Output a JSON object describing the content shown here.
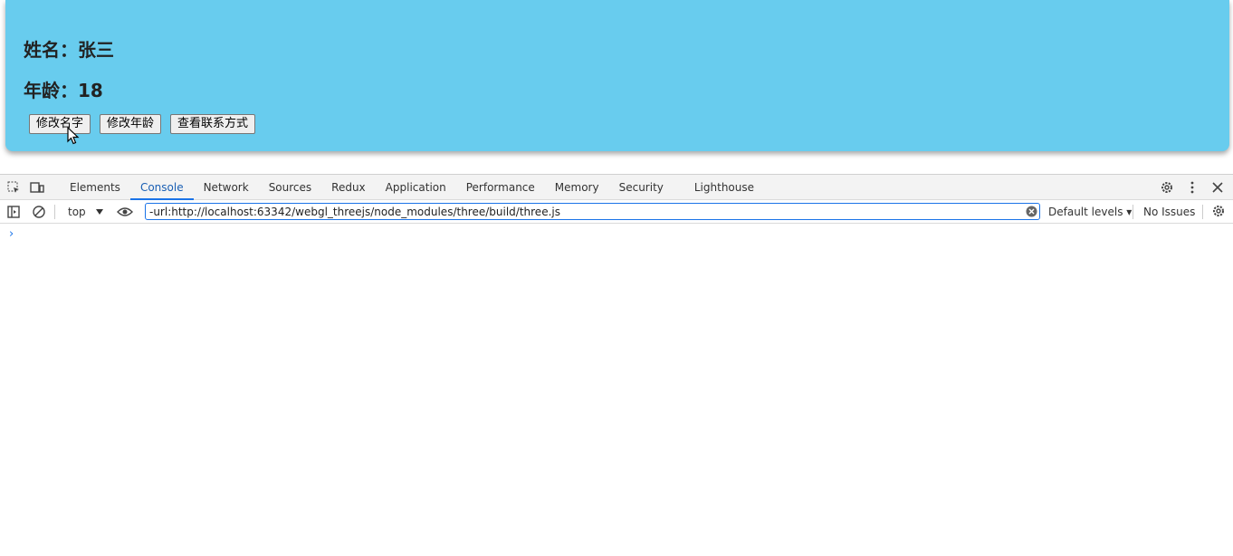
{
  "page": {
    "name_line": "姓名：张三",
    "age_line": "年龄：18",
    "buttons": [
      "修改名字",
      "修改年龄",
      "查看联系方式"
    ],
    "bg_color": "#68ccee"
  },
  "devtools": {
    "tabs": [
      "Elements",
      "Console",
      "Network",
      "Sources",
      "Redux",
      "Application",
      "Performance",
      "Memory",
      "Security",
      "Lighthouse"
    ],
    "active_tab": "Console",
    "context": "top",
    "filter_value": "-url:http://localhost:63342/webgl_threejs/node_modules/three/build/three.js",
    "levels": "Default levels ▾",
    "issues": "No Issues",
    "prompt": "›"
  }
}
